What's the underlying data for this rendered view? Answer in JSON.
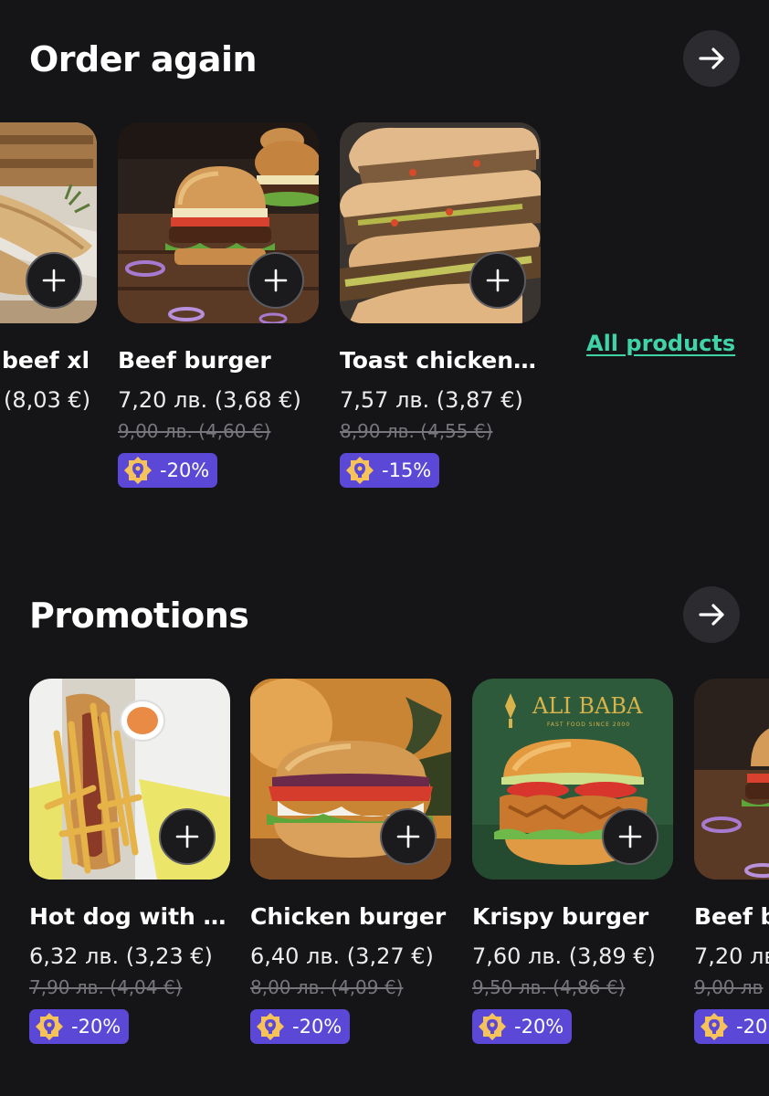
{
  "order_again": {
    "title": "Order again",
    "all_products_label": "All products",
    "products": [
      {
        "name": "beef xl",
        "price": "(8,03 €)"
      },
      {
        "name": "Beef burger",
        "price": "7,20 лв. (3,68 €)",
        "old_price": "9,00 лв. (4,60 €)",
        "discount": "-20%"
      },
      {
        "name": "Toast chicken |...",
        "price": "7,57 лв. (3,87 €)",
        "old_price": "8,90 лв. (4,55 €)",
        "discount": "-15%"
      }
    ]
  },
  "promotions": {
    "title": "Promotions",
    "products": [
      {
        "name": "Hot dog with g...",
        "price": "6,32 лв. (3,23 €)",
        "old_price": "7,90 лв. (4,04 €)",
        "discount": "-20%"
      },
      {
        "name": "Chicken burger",
        "price": "6,40 лв. (3,27 €)",
        "old_price": "8,00 лв. (4,09 €)",
        "discount": "-20%"
      },
      {
        "name": "Krispy burger",
        "price": "7,60 лв. (3,89 €)",
        "old_price": "9,50 лв. (4,86 €)",
        "discount": "-20%"
      },
      {
        "name": "Beef b",
        "price": "7,20 лв",
        "old_price": "9,00 лв",
        "discount": "-20"
      }
    ],
    "brand_logo_text": "ALI BABA",
    "brand_logo_tagline": "FAST FOOD SINCE 2000"
  },
  "colors": {
    "background": "#151417",
    "accent_link": "#3fd3a6",
    "discount_badge": "#5b48d6",
    "badge_icon": "#f6c35a"
  },
  "icons": {
    "arrow": "arrow-right-icon",
    "add": "plus-icon",
    "badge": "discount-badge-icon"
  }
}
